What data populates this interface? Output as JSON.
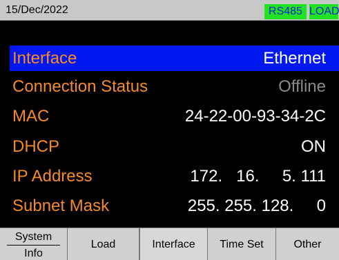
{
  "status": {
    "date": "15/Dec/2022",
    "badges": [
      "RS485",
      "LOAD"
    ]
  },
  "rows": [
    {
      "label": "Interface",
      "value": "Ethernet",
      "selected": true
    },
    {
      "label": "Connection Status",
      "value": "Offline"
    },
    {
      "label": "MAC",
      "value": "24-22-00-93-34-2C"
    },
    {
      "label": "DHCP",
      "value": "ON"
    },
    {
      "label": "IP Address",
      "value": "172.   16.     5. 111"
    },
    {
      "label": "Subnet Mask",
      "value": "255. 255. 128.     0"
    }
  ],
  "softkeys": {
    "system_info_top": "System",
    "system_info_bottom": "Info",
    "load": "Load",
    "interface": "Interface",
    "time_set": "Time Set",
    "other": "Other"
  },
  "colors": {
    "label": "#f48a2a",
    "value": "#ffffff",
    "dim_value": "#8a8a8a",
    "selection": "#0018f0",
    "badge_bg": "#22e322",
    "badge_text": "#0a1ed8"
  }
}
